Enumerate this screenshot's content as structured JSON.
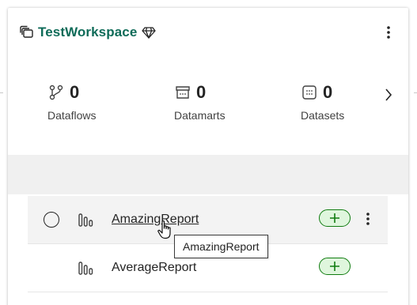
{
  "workspace": {
    "name": "TestWorkspace",
    "title_color": "#0e6b58",
    "icons": {
      "workspace": "workspace-stack-icon",
      "premium": "diamond-icon",
      "more": "more-vertical-icon"
    }
  },
  "stats": [
    {
      "count": "0",
      "label": "Dataflows",
      "icon": "dataflow-icon"
    },
    {
      "count": "0",
      "label": "Datamarts",
      "icon": "datamart-icon"
    },
    {
      "count": "0",
      "label": "Datasets",
      "icon": "dataset-icon"
    }
  ],
  "reports": [
    {
      "name": "AmazingReport",
      "icon": "report-icon",
      "hovered": true,
      "selectable": true
    },
    {
      "name": "AverageReport",
      "icon": "report-icon",
      "hovered": false,
      "selectable": false
    }
  ],
  "tooltip": {
    "text": "AmazingReport"
  },
  "colors": {
    "accent_green": "#107c10",
    "add_fill": "#dff6dd",
    "band": "#f0f0f0",
    "hover_row": "#f3f3f3"
  }
}
